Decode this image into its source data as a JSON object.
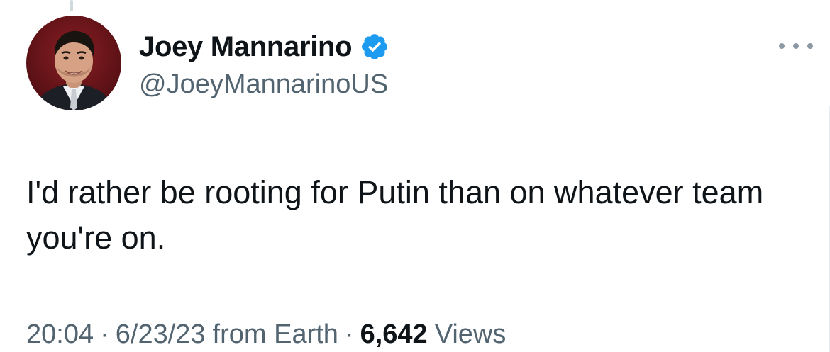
{
  "author": {
    "display_name": "Joey Mannarino",
    "handle": "@JoeyMannarinoUS",
    "verified": true,
    "avatar_icon": "profile-photo"
  },
  "tweet": {
    "text": "I'd rather be rooting for Putin than on whatever team you're on."
  },
  "meta": {
    "time": "20:04",
    "separator": "·",
    "date": "6/23/23",
    "source": "from Earth",
    "views_count": "6,642",
    "views_label": "Views"
  },
  "colors": {
    "verified_blue": "#1d9bf0",
    "secondary_text": "#536471",
    "primary_text": "#0f1419"
  },
  "icons": {
    "verified": "verified-badge-icon",
    "more": "more-options-icon"
  }
}
